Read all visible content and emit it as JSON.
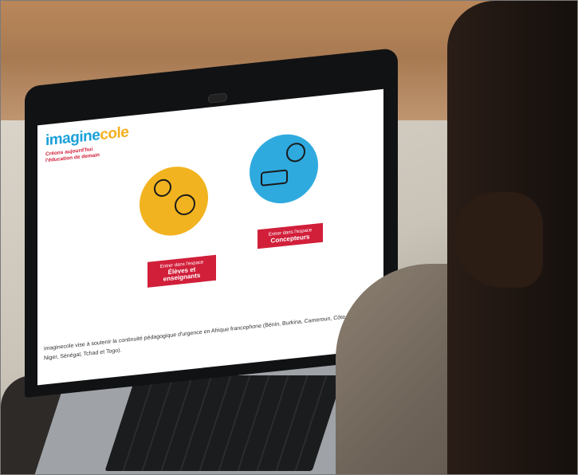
{
  "screen": {
    "logo": {
      "part1": "imagine",
      "part2": "cole",
      "accent_color": "#1aa0d8",
      "secondary_color": "#f2b01e"
    },
    "tagline_line1": "Créons aujourd'hui",
    "tagline_line2": "l'éducation de demain",
    "button_students": {
      "line1": "Entrer dans l'espace",
      "line2": "Élèves et enseignants"
    },
    "button_designers": {
      "line1": "Entrer dans l'espace",
      "line2": "Concepteurs"
    },
    "description": "imaginecole vise à soutenir la continuité pédagogique d'urgence en Afrique francophone (Bénin, Burkina, Cameroun, Côte d'Ivoire, Guinée Conakry, Niger, Sénégal, Tchad et Togo)."
  },
  "colors": {
    "brand_red": "#d11f3a",
    "circle_yellow": "#f2b320",
    "circle_blue": "#2eaadf"
  }
}
